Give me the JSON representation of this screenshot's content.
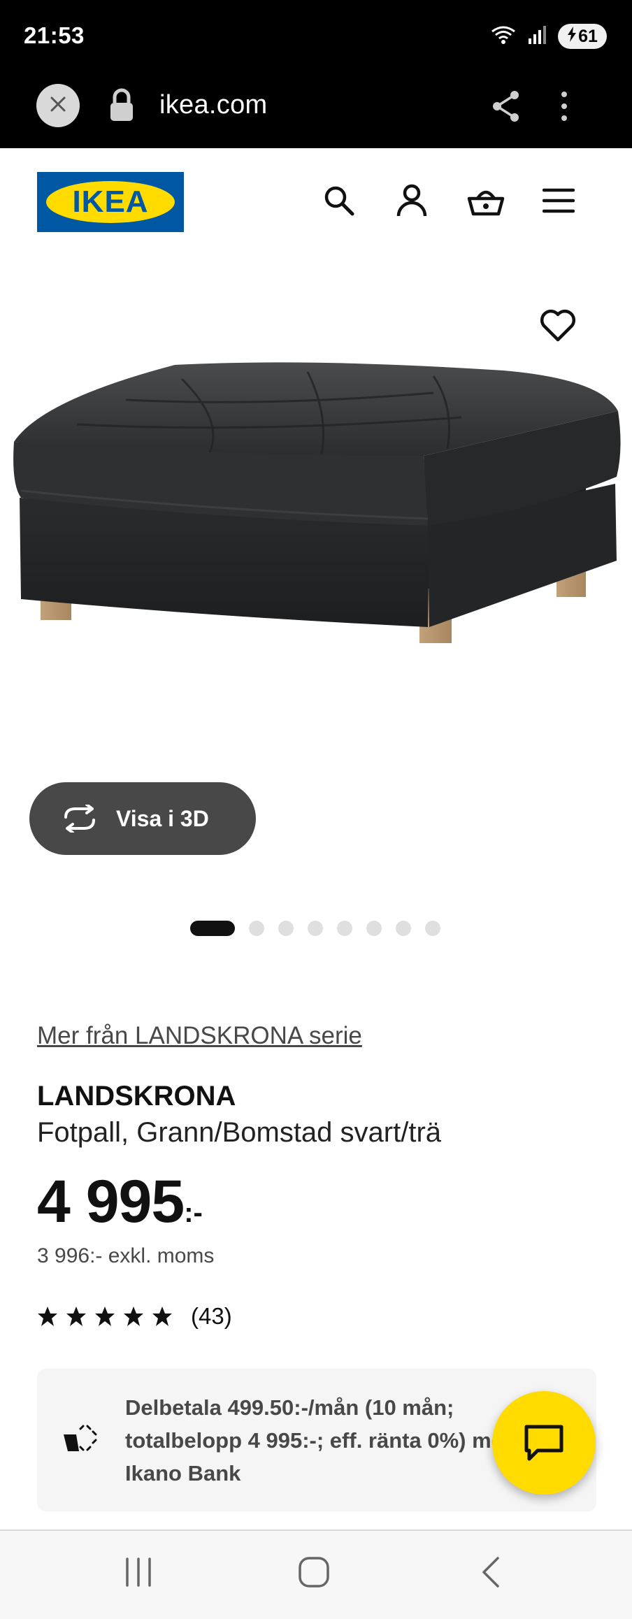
{
  "status_bar": {
    "time": "21:53",
    "battery": "61"
  },
  "browser": {
    "url": "ikea.com"
  },
  "header": {
    "logo_text": "IKEA"
  },
  "media": {
    "view_3d_label": "Visa i 3D",
    "carousel_total": 8,
    "carousel_active": 1
  },
  "product": {
    "series_link": "Mer från LANDSKRONA serie",
    "name": "LANDSKRONA",
    "description": "Fotpall, Grann/Bomstad svart/trä",
    "price": "4 995",
    "price_suffix": ":-",
    "price_excl_vat": "3 996:- exkl. moms",
    "rating_stars": 5,
    "rating_count": "(43)"
  },
  "financing": {
    "text": "Delbetala 499.50:-/mån (10 mån; totalbelopp 4 995:-; eff. ränta 0%) med Ikano Bank"
  },
  "colors": {
    "ikea_blue": "#0058a3",
    "ikea_yellow": "#ffdb00",
    "button_dark": "#484848"
  },
  "icons": {
    "header": [
      "search-icon",
      "account-icon",
      "basket-icon",
      "menu-icon"
    ],
    "browser": [
      "close-icon",
      "lock-icon",
      "share-icon",
      "more-vert-icon"
    ]
  }
}
